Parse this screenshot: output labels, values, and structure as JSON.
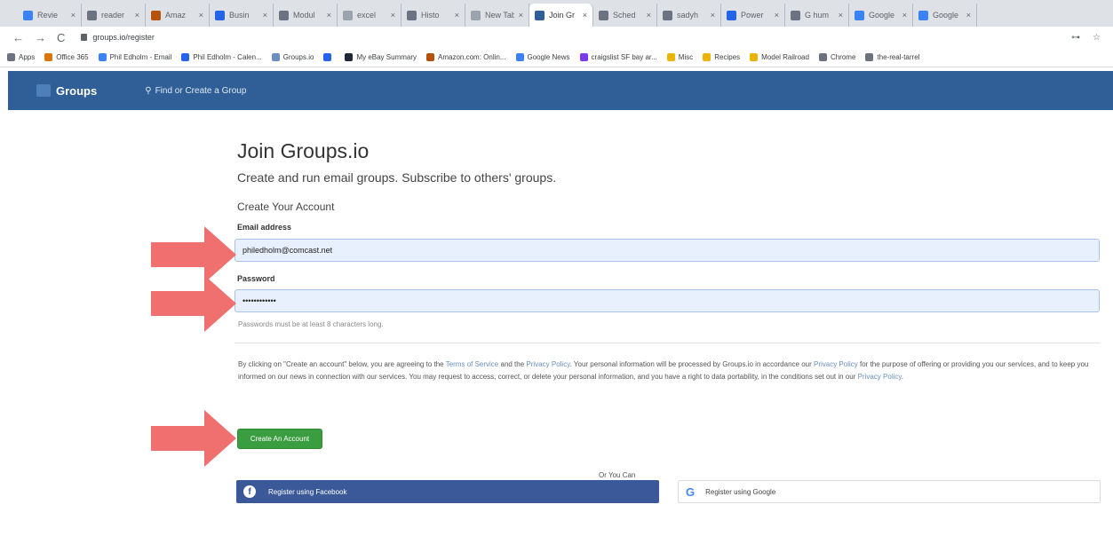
{
  "browser": {
    "tabs": [
      {
        "title": "Revie",
        "color": "#3b82f6"
      },
      {
        "title": "reader",
        "color": "#6b7280"
      },
      {
        "title": "Amaz",
        "color": "#b45309"
      },
      {
        "title": "Busin",
        "color": "#2563eb"
      },
      {
        "title": "Modul",
        "color": "#6b7280"
      },
      {
        "title": "excel",
        "color": "#9ca3af"
      },
      {
        "title": "Histo",
        "color": "#6b7280"
      },
      {
        "title": "New Tab",
        "color": "#9ca3af"
      },
      {
        "title": "Join Gr",
        "color": "#2f5f96",
        "active": true
      },
      {
        "title": "Sched",
        "color": "#6b7280"
      },
      {
        "title": "sadyh",
        "color": "#6b7280"
      },
      {
        "title": "Power",
        "color": "#2563eb"
      },
      {
        "title": "G hum",
        "color": "#6b7280"
      },
      {
        "title": "Google",
        "color": "#3b82f6"
      },
      {
        "title": "Google",
        "color": "#3b82f6"
      }
    ],
    "close_glyph": "×",
    "url": "groups.io/register",
    "nav": {
      "back": "←",
      "forward": "→",
      "reload": "C"
    },
    "right_icons": {
      "key": "⊶",
      "star": "☆"
    },
    "bookmarks": [
      {
        "label": "Apps",
        "color": "#6b7280"
      },
      {
        "label": "Office 365",
        "color": "#d97706"
      },
      {
        "label": "Phil Edholm - Email",
        "color": "#3b82f6"
      },
      {
        "label": "Phil Edholm - Calen...",
        "color": "#2563eb"
      },
      {
        "label": "Groups.io",
        "color": "#6b8fc2"
      },
      {
        "label": "",
        "color": "#2563eb"
      },
      {
        "label": "My eBay Summary",
        "color": "#1f2937"
      },
      {
        "label": "Amazon.com: Onlin...",
        "color": "#b45309"
      },
      {
        "label": "Google News",
        "color": "#3b82f6"
      },
      {
        "label": "craigslist SF bay ar...",
        "color": "#7c3aed"
      },
      {
        "label": "Misc",
        "color": "#eab308"
      },
      {
        "label": "Recipes",
        "color": "#eab308"
      },
      {
        "label": "Model Railroad",
        "color": "#eab308"
      },
      {
        "label": "Chrome",
        "color": "#6b7280"
      },
      {
        "label": "the-real-tarrel",
        "color": "#6b7280"
      }
    ]
  },
  "site_nav": {
    "brand": "Groups",
    "find_link": "Find or Create a Group",
    "search_glyph": "⚲"
  },
  "page": {
    "title": "Join Groups.io",
    "subtitle": "Create and run email groups. Subscribe to others' groups.",
    "section": "Create Your Account",
    "email": {
      "label": "Email address",
      "value": "philedholm@comcast.net"
    },
    "password": {
      "label": "Password",
      "value": "••••••••••••"
    },
    "password_help": "Passwords must be at least 8 characters long.",
    "terms": {
      "t1": "By clicking on \"Create an account\" below, you are agreeing to the ",
      "link1": "Terms of Service",
      "t2": " and the ",
      "link2": "Privacy Policy",
      "t3": ". Your personal information will be processed by Groups.io in accordance our ",
      "link3": "Privacy Policy",
      "t4": " for the purpose of offering or providing you our services, and to keep you informed on our news in connection with our services. You may request to access, correct, or delete your personal information, and you have a right to data portability, in the conditions set out in our ",
      "link4": "Privacy Policy",
      "t5": "."
    },
    "create_button": "Create An Account",
    "or_text": "Or You Can",
    "facebook": {
      "label": "Register using Facebook",
      "logo": "f"
    },
    "google": {
      "label": "Register using Google",
      "logo": "G"
    }
  },
  "colors": {
    "nav_bg": "#2f5f96",
    "create_btn": "#3a9d3f",
    "facebook_btn": "#3b5998",
    "arrow": "#f07070"
  }
}
